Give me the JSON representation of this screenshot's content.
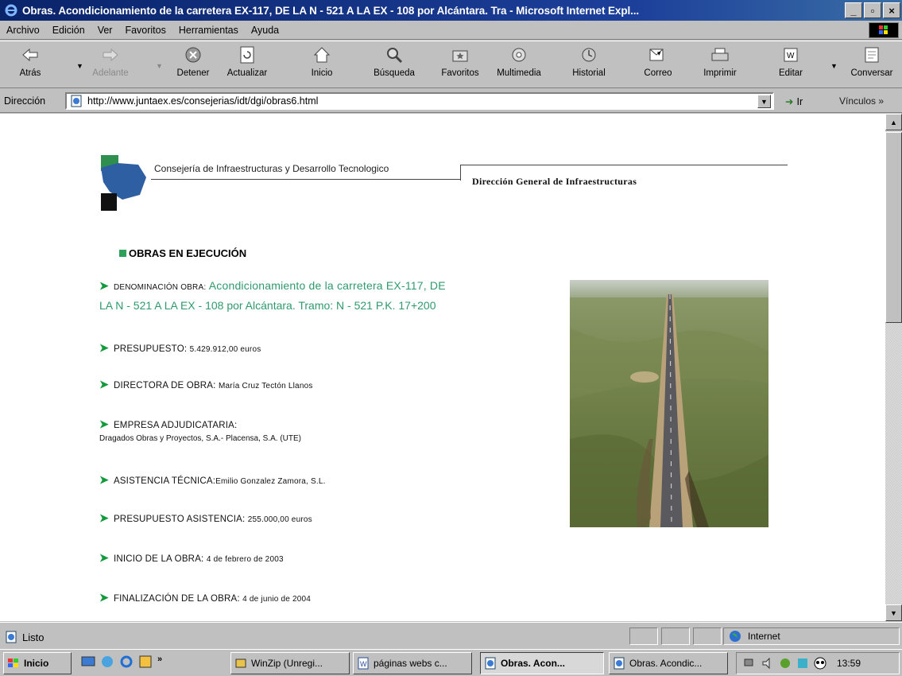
{
  "window": {
    "title": "Obras. Acondicionamiento de la carretera EX-117, DE LA N - 521 A LA EX - 108 por Alcántara. Tra - Microsoft Internet Expl...",
    "controls": [
      "_",
      "▫",
      "×"
    ]
  },
  "menu": [
    "Archivo",
    "Edición",
    "Ver",
    "Favoritos",
    "Herramientas",
    "Ayuda"
  ],
  "toolbar": [
    {
      "label": "Atrás",
      "icon": "back-arrow-icon"
    },
    {
      "label": "Adelante",
      "icon": "forward-arrow-icon",
      "disabled": true
    },
    {
      "label": "Detener",
      "icon": "stop-icon"
    },
    {
      "label": "Actualizar",
      "icon": "refresh-icon"
    },
    {
      "label": "Inicio",
      "icon": "home-icon"
    },
    {
      "label": "Búsqueda",
      "icon": "search-icon"
    },
    {
      "label": "Favoritos",
      "icon": "favorites-icon"
    },
    {
      "label": "Multimedia",
      "icon": "multimedia-icon"
    },
    {
      "label": "Historial",
      "icon": "history-icon"
    },
    {
      "label": "Correo",
      "icon": "mail-icon"
    },
    {
      "label": "Imprimir",
      "icon": "print-icon"
    },
    {
      "label": "Editar",
      "icon": "edit-icon"
    },
    {
      "label": "Conversar",
      "icon": "discuss-icon"
    }
  ],
  "address": {
    "label": "Dirección",
    "url": "http://www.juntaex.es/consejerias/idt/dgi/obras6.html",
    "go": "Ir",
    "links": "Vínculos »"
  },
  "page": {
    "header_org": "Consejería de Infraestructuras y Desarrollo Tecnologico",
    "header_dept": "Dirección General de Infraestructuras",
    "section_title": "OBRAS EN EJECUCIÓN",
    "items": [
      {
        "label": "DENOMINACIÓN OBRA:",
        "value": "Acondicionamiento de la carretera EX-117, DE",
        "value2": "LA N - 521 A LA EX - 108 por Alcántara. Tramo: N - 521 P.K. 17+200"
      },
      {
        "label": "PRESUPUESTO:",
        "value": "5.429.912,00 euros"
      },
      {
        "label": "DIRECTORA DE OBRA:",
        "value": "María Cruz Tectón Llanos"
      },
      {
        "label": "EMPRESA ADJUDICATARIA:",
        "value": "Dragados Obras y Proyectos, S.A.- Placensa, S.A. (UTE)"
      },
      {
        "label": "ASISTENCIA TÉCNICA:",
        "value": "Emilio Gonzalez Zamora, S.L."
      },
      {
        "label": "PRESUPUESTO ASISTENCIA:",
        "value": "255.000,00 euros"
      },
      {
        "label": "INICIO DE LA OBRA:",
        "value": "4 de febrero de 2003"
      },
      {
        "label": "FINALIZACIÓN DE LA OBRA:",
        "value": "4 de junio de 2004"
      }
    ]
  },
  "status": {
    "text": "Listo",
    "zone": "Internet"
  },
  "taskbar": {
    "start": "Inicio",
    "chevron": "»",
    "tasks": [
      "WinZip (Unregi...",
      "páginas webs c...",
      "Obras. Acon...",
      "Obras. Acondic..."
    ],
    "clock": "13:59"
  }
}
